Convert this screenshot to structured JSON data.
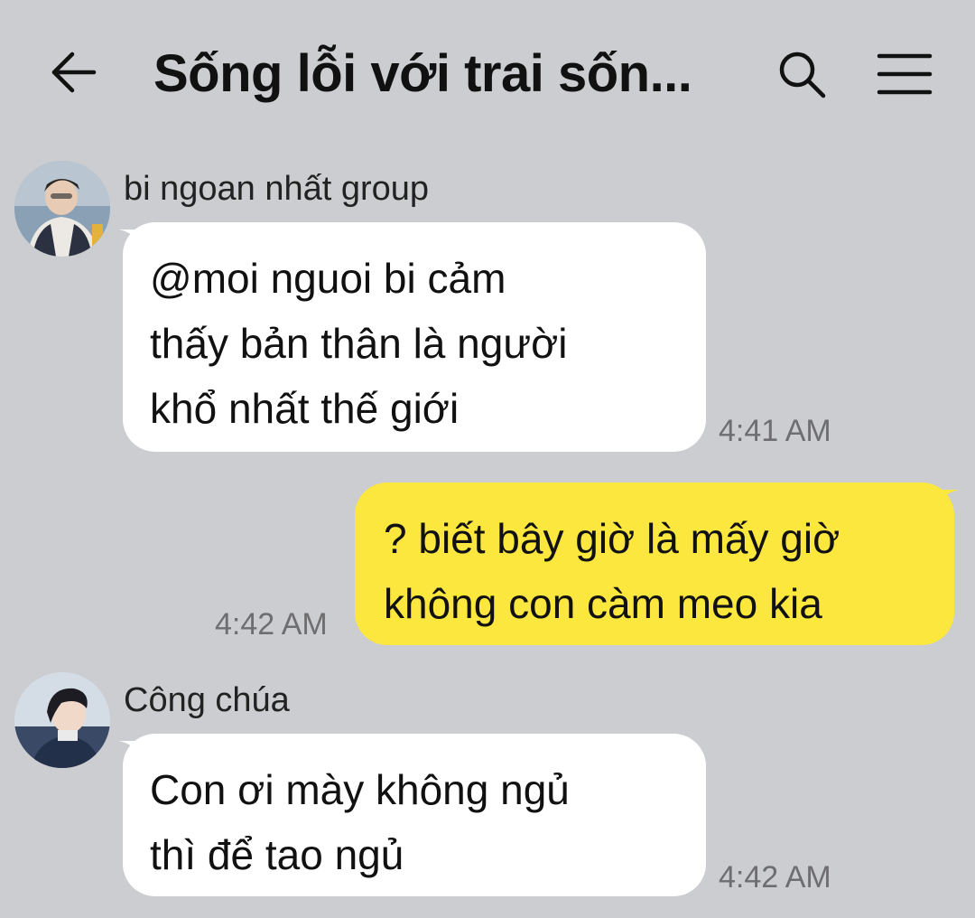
{
  "header": {
    "title": "Sống lỗi với trai sốn...",
    "back_icon": "back-arrow-icon",
    "search_icon": "search-icon",
    "menu_icon": "hamburger-menu-icon"
  },
  "messages": [
    {
      "sender": "bi ngoan nhất group",
      "avatar": "avatar-icon",
      "direction": "incoming",
      "lines": [
        "@moi nguoi bi cảm",
        "thấy bản thân là người",
        "khổ nhất thế giới"
      ],
      "time": "4:41 AM"
    },
    {
      "sender": "",
      "direction": "outgoing",
      "lines": [
        "? biết bây giờ là mấy giờ",
        "không con càm meo kia"
      ],
      "time": "4:42 AM"
    },
    {
      "sender": "Công chúa",
      "avatar": "avatar-icon",
      "direction": "incoming",
      "lines": [
        "Con ơi mày không ngủ",
        "thì để tao ngủ"
      ],
      "time": "4:42 AM"
    }
  ],
  "colors": {
    "background": "#cccdd0",
    "incoming_bubble": "#ffffff",
    "outgoing_bubble": "#fbe73e",
    "timestamp": "#6e6e70"
  }
}
